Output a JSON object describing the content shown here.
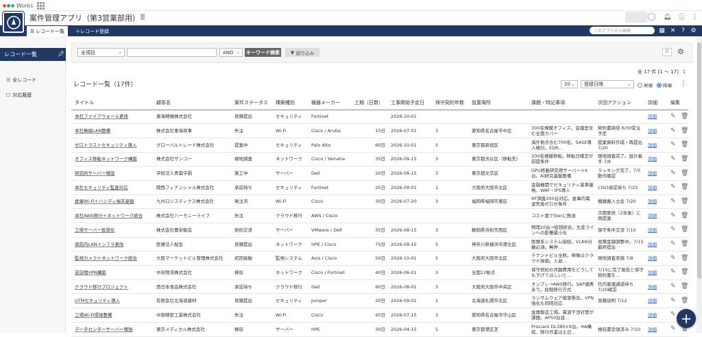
{
  "brand": {
    "name": "Works"
  },
  "app": {
    "title": "案件管理アプリ（第3営業部用）"
  },
  "nav": {
    "list_label": "レコード一覧",
    "add_label": "＋レコード登録",
    "search_placeholder": "このアプリから検索"
  },
  "sidebar": {
    "title": "レコード一覧",
    "items": [
      {
        "label": "全レコード"
      },
      {
        "label": "対応履歴"
      }
    ]
  },
  "filter": {
    "field": "全項目",
    "keyword": "",
    "operator": "AND",
    "keyword_button": "キーワード検索",
    "narrow_button": "絞り込み"
  },
  "list": {
    "title": "レコード一覧（17件）",
    "count_text": "全 17 件 [1 〜 17]",
    "page": "1",
    "per_page": "20",
    "sort_field": "登録日時",
    "sort_asc": "昇順",
    "sort_desc": "降順"
  },
  "columns": [
    "タイトル",
    "顧客名",
    "案件ステータス",
    "構築種別",
    "機器メーカー",
    "工期（日数）",
    "工事開始予定日",
    "保守契約年数",
    "設置場所",
    "課題・特記事項",
    "次回アクション",
    "詳細",
    "編集"
  ],
  "rows": [
    [
      "本社ファイアウォール更改",
      "東海精機株式会社",
      "見積提出",
      "セキュリティ",
      "Fortinet",
      "",
      "2026-10-01",
      "",
      "",
      "",
      "",
      "詳細"
    ],
    [
      "本社無線LAN整備",
      "株式会社東海商事",
      "失注",
      "Wi-Fi",
      "Cisco / Aruba",
      "15日",
      "2026-07-01",
      "3",
      "愛知県名古屋市中区",
      "300名規模オフィス。会議室含む全面カバー",
      "契約書締結 6/30受注予定",
      "詳細"
    ],
    [
      "ゼロトラストセキュリティ導入",
      "グローバルトレード株式会社",
      "提案中",
      "セキュリティ",
      "Palo Alto",
      "60日",
      "2026-10-01",
      "5",
      "東京都新宿区",
      "海外拠点含む700名。SASE導入検討。EDR…",
      "提案資料作成・再提出 7/20",
      "詳細"
    ],
    [
      "オフィス移転ネットワーク構築",
      "株式会社サンコー",
      "現地調査",
      "ネットワーク",
      "Cisco / Yamaha",
      "35日",
      "2026-09-15",
      "3",
      "東京都渋谷区（移転先）",
      "200名規模移転。移転日確定が前提条件",
      "現地調査完了。設計着手 7/8",
      "詳細"
    ],
    [
      "研究所サーバー増設",
      "学校法人青葉学園",
      "施工中",
      "サーバー",
      "Dell",
      "20日",
      "2026-06-15",
      "3",
      "東京都文京区",
      "GPU搭載研究用サーバー×4台。AI研究基盤整備",
      "ラッキング完了。7/5動作確認",
      "詳細"
    ],
    [
      "本社セキュリティ監査対応",
      "関西フィナンシャル株式会社",
      "承認待ち",
      "セキュリティ",
      "Fortinet",
      "25日",
      "2026-09-01",
      "1",
      "大阪府大阪市北区",
      "金融機関でセキュリティ基準厳格。WAF・IPS導入",
      "CISO承認待ち 7/25",
      "詳細"
    ],
    [
      "倉庫Wi-Fi＋ハンディ端末基盤",
      "九州ロジスティクス株式会社",
      "発注済",
      "Wi-Fi",
      "Cisco",
      "30日",
      "2026-07-20",
      "3",
      "福岡県福岡市東区",
      "RF調査200台対応。倉庫内電波死角ゼロが条件",
      "機器搬入立会 7/20",
      "詳細"
    ],
    [
      "本社AWS移行＋ネットワーク統合",
      "株式会社ハーモニーライフ",
      "失注",
      "クラウド移行",
      "AWS / Cisco",
      "",
      "",
      "",
      "",
      "コスト面でSIerに敗退",
      "次期更改（2年後）に再提案",
      "詳細"
    ],
    [
      "工場サーバー仮想化",
      "株式会社豊栄製造",
      "契約交渉",
      "サーバー",
      "VMware / Dell",
      "35日",
      "2026-08-15",
      "3",
      "静岡県浜松市西区",
      "物理20台→仮想統合。生産ラインへの影響最小化",
      "保守条件交渉 7/10",
      "詳細"
    ],
    [
      "病院内LANインフラ更改",
      "医療法人桜会",
      "見積提出",
      "ネットワーク",
      "HPE / Cisco",
      "75日",
      "2026-09-15",
      "5",
      "神奈川県横浜市港北区",
      "医療系システム接続。VLAN分離必須。無停…",
      "見積金額調整中。7/15最終提出",
      "詳細"
    ],
    [
      "監視カメラ＋ネットワーク統合",
      "大阪マーケットビル管理株式会社",
      "初回接触",
      "監視システム",
      "Axis / Cisco",
      "50日",
      "2026-10-01",
      "5",
      "大阪府大阪市北区",
      "テナントビル全館。映像はクラウド録画。入退…",
      "現地調査実施 7/8",
      "詳細"
    ],
    [
      "支店間VPN構築",
      "中央物流株式会社",
      "検収",
      "ネットワーク",
      "Cisco / Fortinet",
      "40日",
      "2026-06-01",
      "3",
      "全国12拠点",
      "保守契約の月額費用をどうしても下げてほしいと…",
      "7/15に完了報告と保守契約書を…",
      "詳細"
    ],
    [
      "クラウド移行プロジェクト",
      "西日本食品株式会社",
      "承認待ち",
      "クラウド移行",
      "Dell",
      "90日",
      "2026-08-01",
      "3",
      "大阪府大阪市中央区",
      "オンプレ→AWS移行。SAP連携あり。段階移行方式",
      "社内稟議通過待ち 7/20確認",
      "詳細"
    ],
    [
      "UTMセキュリティ導入",
      "有限会社北海道建材",
      "見積提出",
      "セキュリティ",
      "Juniper",
      "20日",
      "2026-09-01",
      "1",
      "北海道札幌市北区",
      "ランサムウェア被害懸念。VPN強化も同時対応",
      "見積説明 7/12",
      "詳細"
    ],
    [
      "工場Wi-Fi環境整備",
      "中部精密工業株式会社",
      "失注",
      "Wi-Fi",
      "Cisco",
      "45日",
      "2026-07-15",
      "3",
      "愛知県名古屋市守山区",
      "金属製造工場。電波干渉対策が課題。AP50台設…",
      "",
      "詳細"
    ],
    [
      "データセンターサーバー増強",
      "東京メディカル株式会社",
      "検収",
      "サーバー",
      "HPE",
      "30日",
      "2026-04-15",
      "5",
      "東京都港区芝",
      "ProLiant DL380×8台。HA構成、移行作業は土日…",
      "検収書受領済み 7/10",
      "詳細"
    ]
  ],
  "colors": {
    "navy": "#1f3864",
    "link": "#2b6cd6"
  },
  "icons": [
    "grid-icon",
    "bell-icon",
    "help-icon",
    "user-icon",
    "settings-icon",
    "edit-icon",
    "trash-icon",
    "comment-icon",
    "plus-icon",
    "pin-icon",
    "list-icon",
    "more-icon"
  ]
}
